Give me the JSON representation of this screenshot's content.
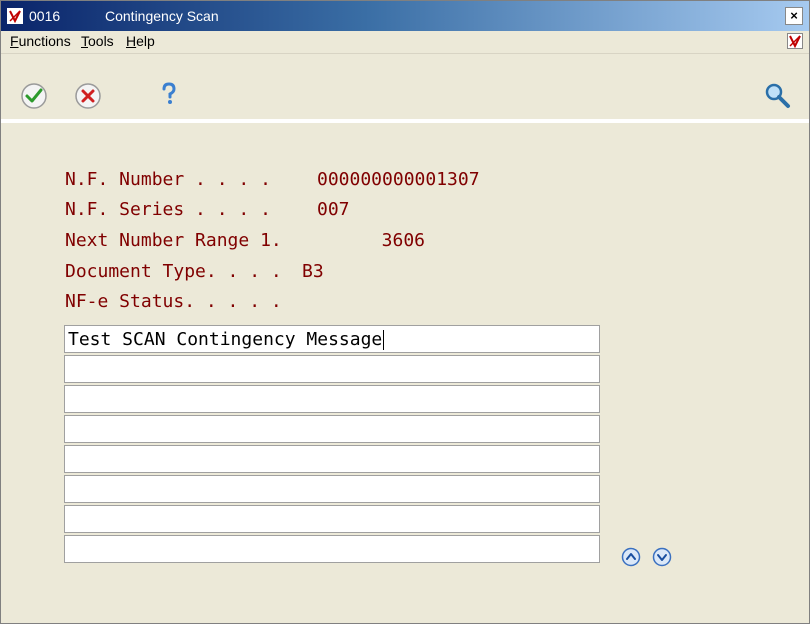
{
  "window": {
    "code": "0016",
    "title": "Contingency Scan",
    "close_glyph": "×"
  },
  "menu": {
    "items": [
      {
        "first": "F",
        "rest": "unctions"
      },
      {
        "first": "T",
        "rest": "ools"
      },
      {
        "first": "H",
        "rest": "elp"
      }
    ]
  },
  "toolbar": {
    "ok_icon": "checkmark-icon",
    "cancel_icon": "cancel-x-icon",
    "help_icon": "question-icon",
    "search_icon": "magnifier-icon"
  },
  "fields": {
    "nf_number": {
      "label": "N.F. Number . . . .",
      "value": "000000000001307"
    },
    "nf_series": {
      "label": "N.F. Series . . . .",
      "value": "007"
    },
    "next_range": {
      "label": "Next Number Range 1.",
      "value": "3606"
    },
    "doc_type": {
      "label": "Document Type. . . .",
      "value": "B3"
    },
    "nfe_status": {
      "label": "NF-e Status. . . . .",
      "value": ""
    }
  },
  "messages": [
    "Test SCAN Contingency Message",
    "",
    "",
    "",
    "",
    "",
    "",
    ""
  ],
  "colors": {
    "label": "#800000",
    "titlebar_start": "#0a246a",
    "titlebar_end": "#a6caf0"
  }
}
